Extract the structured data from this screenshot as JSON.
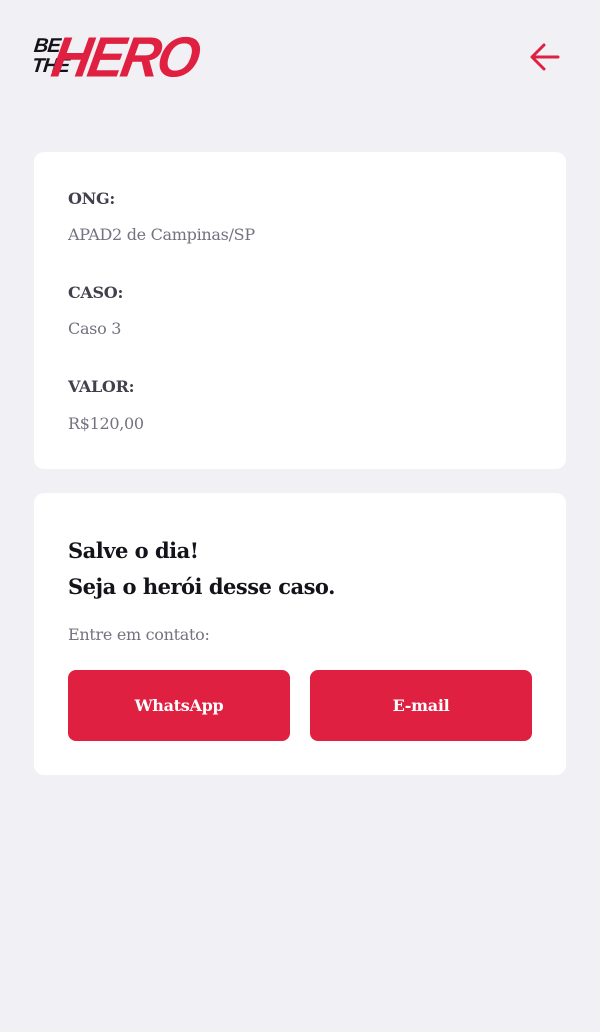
{
  "logo": {
    "line1": "BE",
    "line2": "THE",
    "word": "HERO"
  },
  "header": {
    "back_icon": "arrow-left-icon"
  },
  "incident": {
    "ong_label": "ONG:",
    "ong_value": "APAD2 de Campinas/SP",
    "case_label": "CASO:",
    "case_value": "Caso 3",
    "value_label": "VALOR:",
    "value_value": "R$120,00"
  },
  "contact": {
    "title_line1": "Salve o dia!",
    "title_line2": "Seja o herói desse caso.",
    "subtitle": "Entre em contato:",
    "whatsapp_label": "WhatsApp",
    "email_label": "E-mail"
  },
  "colors": {
    "brand": "#e02041",
    "background": "#f0f0f5",
    "card": "#ffffff"
  }
}
